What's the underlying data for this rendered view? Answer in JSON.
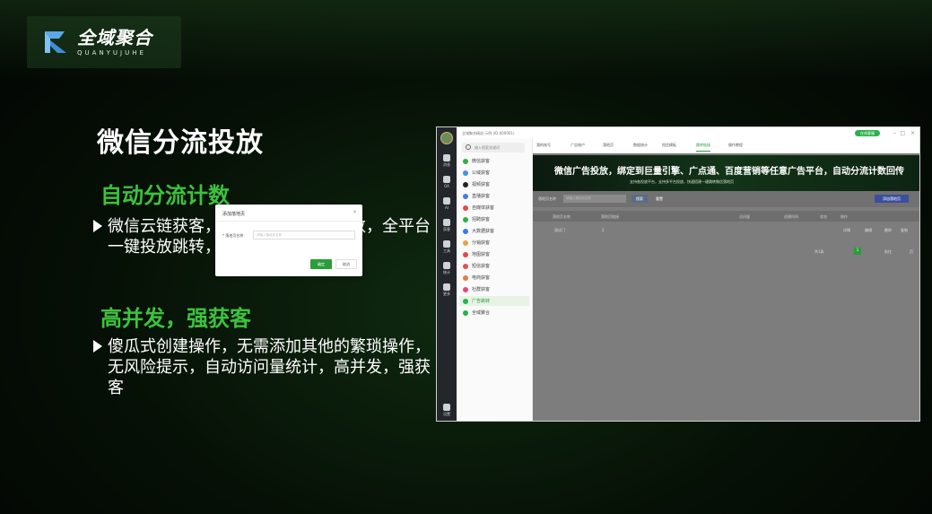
{
  "logo": {
    "title": "全域聚合",
    "subtitle": "QUANYUJUHE"
  },
  "slide": {
    "title": "微信分流投放",
    "section1": {
      "heading": "自动分流计数",
      "text": "微信云链获客，自动分流，自动计数，全平台一键投放跳转，支持自定义域名"
    },
    "section2": {
      "heading": "高并发，强获客",
      "text": "傻瓜式创建操作，无需添加其他的繁琐操作，无风险提示，自动访问量统计，高并发，强获客"
    }
  },
  "app": {
    "title_text": "全域聚合精选·示例 (ID:000001)",
    "online_badge": "在线客服",
    "search_placeholder": "输入搜索关键词",
    "sidebar": [
      {
        "label": "消息",
        "icon": "message-icon"
      },
      {
        "label": "OA",
        "icon": "office-icon"
      },
      {
        "label": "AI",
        "icon": "ai-icon"
      },
      {
        "label": "获客",
        "icon": "user-icon"
      },
      {
        "label": "工具",
        "icon": "tool-icon"
      },
      {
        "label": "统计",
        "icon": "chart-icon"
      },
      {
        "label": "更多",
        "icon": "grid-icon"
      },
      {
        "label": "设置",
        "icon": "settings-icon"
      }
    ],
    "list": [
      {
        "label": "微信获客",
        "color": "#2bb14a"
      },
      {
        "label": "公域获客",
        "color": "#4a90e2"
      },
      {
        "label": "视频获客",
        "color": "#222222"
      },
      {
        "label": "直播获客",
        "color": "#4a7be2"
      },
      {
        "label": "自媒体获客",
        "color": "#e24a4a"
      },
      {
        "label": "招聘获客",
        "color": "#2bb14a"
      },
      {
        "label": "大数据获客",
        "color": "#3a7be2"
      },
      {
        "label": "分销获客",
        "color": "#e2a44a"
      },
      {
        "label": "地图获客",
        "color": "#e24a4a"
      },
      {
        "label": "短信获客",
        "color": "#e2544a"
      },
      {
        "label": "电商获客",
        "color": "#e27a4a"
      },
      {
        "label": "社群获客",
        "color": "#e24a7a"
      },
      {
        "label": "广告跳转",
        "color": "#2bb14a"
      },
      {
        "label": "全域聚合",
        "color": "#2bb14a"
      }
    ],
    "tabs": [
      "我的账号",
      "广告账户",
      "落地页",
      "数据统计",
      "短信模板",
      "跳转链接",
      "操作教程"
    ],
    "active_tab": 5,
    "banner_title": "微信广告投放，绑定到巨量引擎、广点通、百度营销等任意广告平台，自动分流计数回传",
    "banner_sub": "支持各投放平台，支持多平台投放，快速搭建一键跳转微信落地页",
    "toolbar": {
      "label": "落地页名称",
      "placeholder": "请输入落地页名称",
      "search": "搜索",
      "reset": "重置",
      "add": "添加落地页"
    },
    "table_headers": [
      "落地页名称",
      "落地页链接",
      "访问量",
      "创建时间",
      "状态",
      "操作"
    ],
    "row": {
      "name": "测试门",
      "count": "2",
      "actions": [
        "详情",
        "编辑",
        "删除",
        "复制"
      ]
    },
    "pagination": {
      "total": "共1条",
      "page": "1",
      "goto": "前往",
      "page_suffix": "页"
    },
    "modal": {
      "title": "添加落地页",
      "label": "* 落地页名称",
      "placeholder": "请输入落地页名称",
      "ok": "确定",
      "cancel": "取消"
    }
  }
}
